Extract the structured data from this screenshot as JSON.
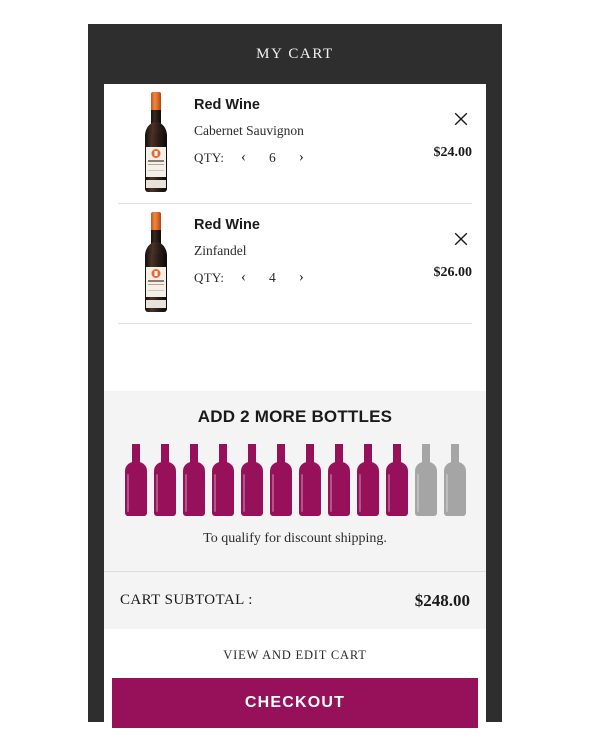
{
  "header": {
    "title": "MY CART"
  },
  "items": [
    {
      "name": "Red Wine",
      "variant": "Cabernet Sauvignon",
      "qty_label": "QTY:",
      "qty_decrement": "‹",
      "qty_value": "6",
      "qty_increment": "›",
      "price": "$24.00",
      "remove_label": "Remove item"
    },
    {
      "name": "Red Wine",
      "variant": "Zinfandel",
      "qty_label": "QTY:",
      "qty_decrement": "‹",
      "qty_value": "4",
      "qty_increment": "›",
      "price": "$26.00",
      "remove_label": "Remove item"
    }
  ],
  "promo": {
    "title": "ADD 2 MORE BOTTLES",
    "note": "To qualify for discount shipping.",
    "bottles_total": 12,
    "bottles_filled": 10,
    "bottles_remaining": 2,
    "filled_color": "#961159",
    "empty_color": "#a5a5a5"
  },
  "subtotal": {
    "label": "CART SUBTOTAL :",
    "value": "$248.00"
  },
  "actions": {
    "view_and_edit": "VIEW AND EDIT CART",
    "checkout": "CHECKOUT"
  },
  "theme": {
    "frame": "#2e2e2e",
    "accent": "#961159",
    "panel": "#ffffff",
    "muted_panel": "#f4f4f4"
  }
}
